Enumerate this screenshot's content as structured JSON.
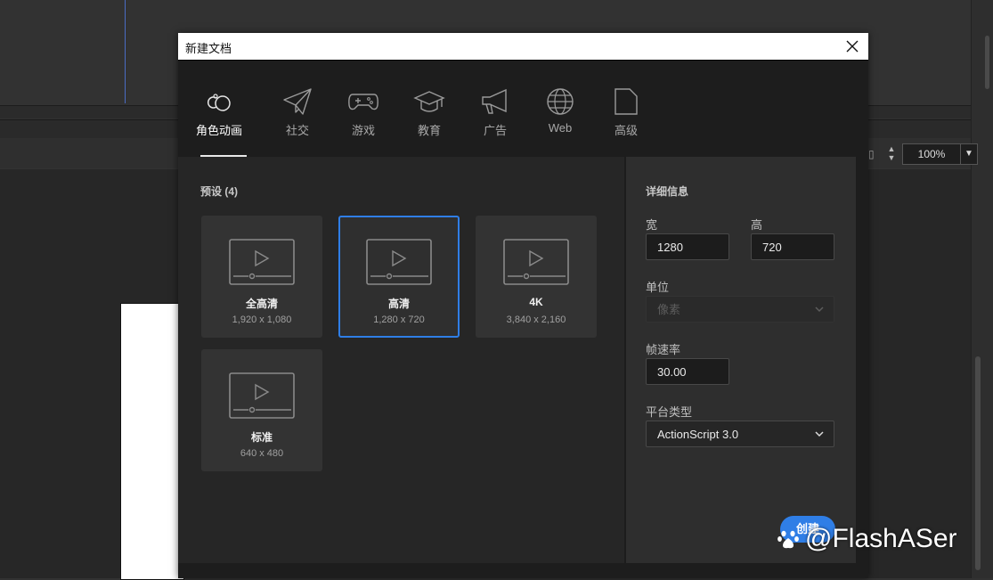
{
  "background": {
    "zoom_value": "100%"
  },
  "dialog": {
    "title": "新建文档",
    "tabs": [
      {
        "label": "角色动画",
        "icon": "character-animation-icon",
        "active": true
      },
      {
        "label": "社交",
        "icon": "paper-plane-icon"
      },
      {
        "label": "游戏",
        "icon": "gamepad-icon"
      },
      {
        "label": "教育",
        "icon": "graduation-cap-icon"
      },
      {
        "label": "广告",
        "icon": "megaphone-icon"
      },
      {
        "label": "Web",
        "icon": "globe-icon"
      },
      {
        "label": "高级",
        "icon": "document-icon"
      }
    ],
    "presets": {
      "heading": "预设 (4)",
      "items": [
        {
          "name": "全高清",
          "dims": "1,920 x 1,080"
        },
        {
          "name": "高清",
          "dims": "1,280 x 720",
          "selected": true
        },
        {
          "name": "4K",
          "dims": "3,840 x 2,160"
        },
        {
          "name": "标准",
          "dims": "640 x 480"
        }
      ]
    },
    "details": {
      "heading": "详细信息",
      "width_label": "宽",
      "width_value": "1280",
      "height_label": "高",
      "height_value": "720",
      "unit_label": "单位",
      "unit_value": "像素",
      "fps_label": "帧速率",
      "fps_value": "30.00",
      "platform_label": "平台类型",
      "platform_value": "ActionScript 3.0",
      "create_label": "创建"
    }
  },
  "watermark": {
    "text": "@FlashASer"
  },
  "colors": {
    "accent": "#2f7ee6",
    "dialog_bg": "#1d1d1d",
    "panel_bg": "#262626",
    "details_bg": "#2e2e2e"
  }
}
